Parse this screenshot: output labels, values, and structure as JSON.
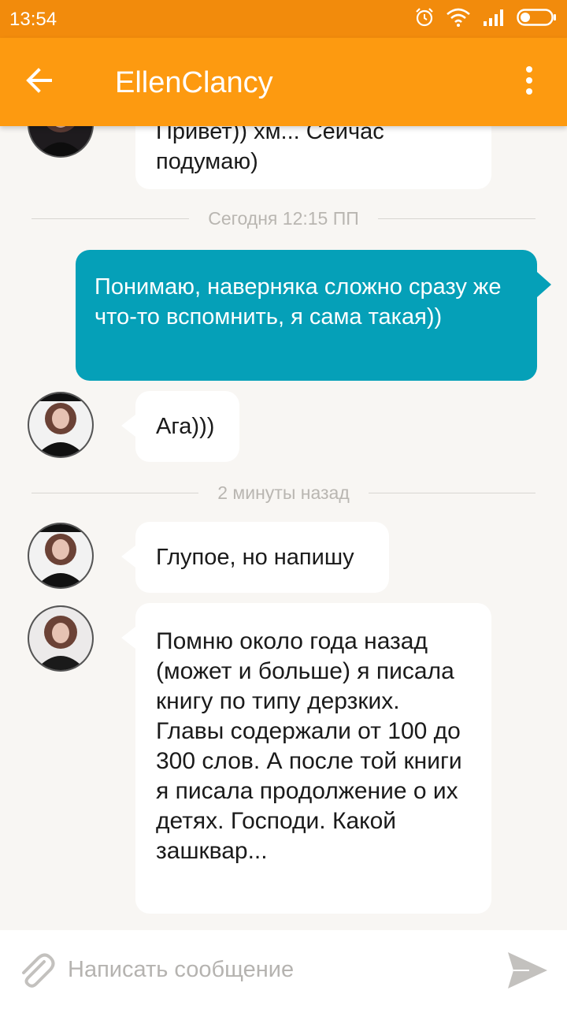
{
  "status_bar": {
    "time": "13:54"
  },
  "app_bar": {
    "title": "EllenClancy"
  },
  "messages": {
    "m1": {
      "text": "Привет)) хм... Сейчас подумаю)"
    },
    "divider1": "Сегодня 12:15 ПП",
    "m2": {
      "text": "Понимаю, наверняка сложно сразу же что-то вспомнить, я сама такая))"
    },
    "m3": {
      "text": "Ага)))"
    },
    "divider2": "2 минуты назад",
    "m4": {
      "text": "Глупое, но напишу"
    },
    "m5": {
      "text": "Помню около года назад (может и больше) я писала книгу по типу дерзких. Главы содержали от 100 до 300 слов. А после той книги я писала продолжение о их детях. Господи. Какой зашквар..."
    }
  },
  "composer": {
    "placeholder": "Написать сообщение"
  },
  "colors": {
    "status_bar": "#f28b0c",
    "app_bar": "#fd9a10",
    "outgoing_bubble": "#05a0b8",
    "background": "#f8f6f3"
  },
  "icons": {
    "alarm": "alarm-icon",
    "wifi": "wifi-icon",
    "signal": "signal-icon",
    "battery": "battery-icon",
    "back": "arrow-left-icon",
    "menu": "more-vert-icon",
    "attach": "paperclip-icon",
    "send": "send-icon"
  }
}
